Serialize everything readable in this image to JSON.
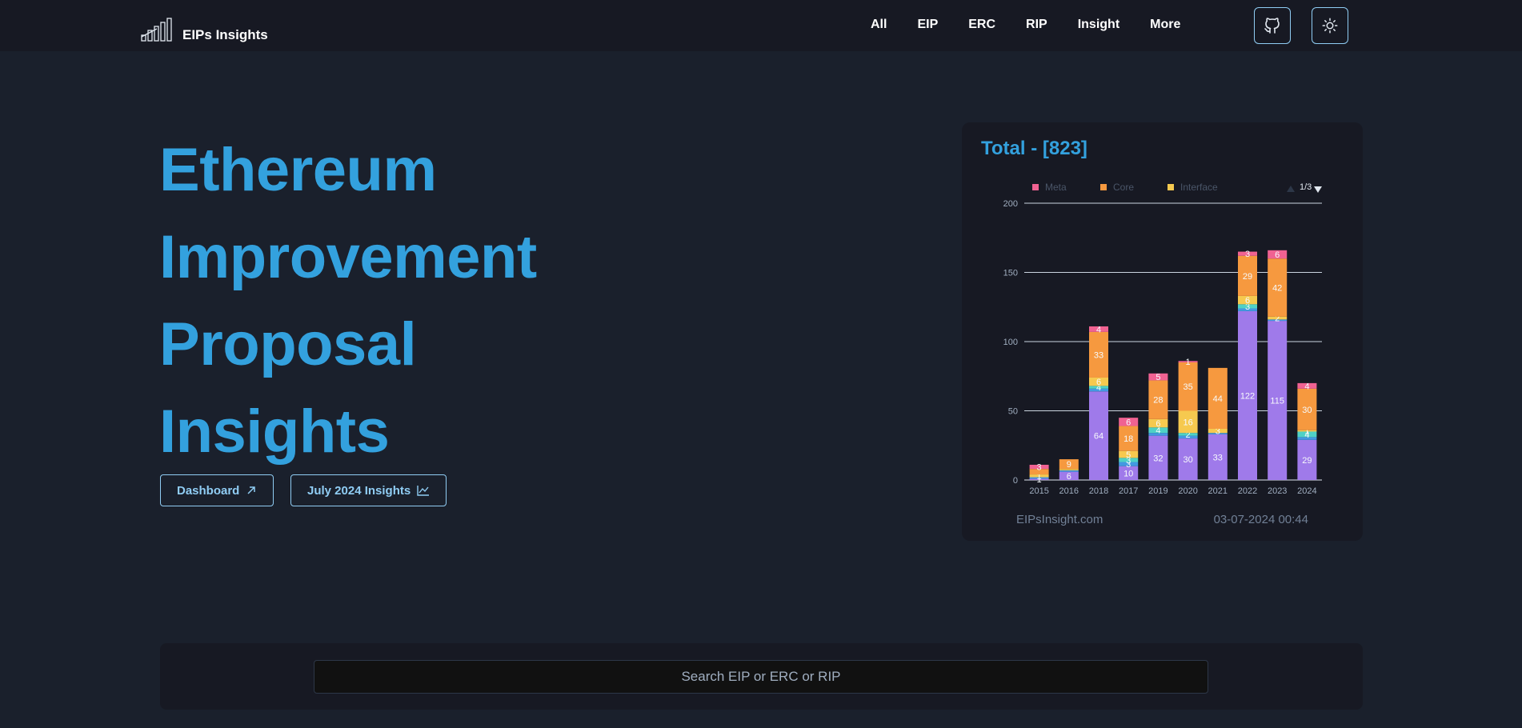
{
  "nav": {
    "brand": "EIPs Insights",
    "links": [
      "All",
      "EIP",
      "ERC",
      "RIP",
      "Insight",
      "More"
    ],
    "github_icon": "github-icon",
    "theme_icon": "sun-icon"
  },
  "hero": {
    "title_lines": [
      "Ethereum",
      "Improvement",
      "Proposal",
      "Insights"
    ],
    "dashboard_label": "Dashboard",
    "insights_label": "July 2024 Insights"
  },
  "chart_card": {
    "title": "Total - [823]",
    "footer_left": "EIPsInsight.com",
    "footer_right": "03-07-2024 00:44",
    "legend_page": "1/3"
  },
  "search": {
    "placeholder": "Search EIP or ERC or RIP"
  },
  "colors": {
    "accent": "#33a1de",
    "meta": "#f06292",
    "core": "#f6993f",
    "interface": "#f6c94f",
    "networking": "#4fd1c5",
    "informational": "#4299e1",
    "standards": "#9f7aea"
  },
  "chart_data": {
    "type": "bar",
    "stacked": true,
    "categories": [
      "2015",
      "2016",
      "2018",
      "2017",
      "2019",
      "2020",
      "2021",
      "2022",
      "2023",
      "2024"
    ],
    "ylim": [
      0,
      200
    ],
    "yticks": [
      0,
      50,
      100,
      150,
      200
    ],
    "grid": true,
    "legend_position": "top",
    "legend": [
      "Meta",
      "Core",
      "Interface"
    ],
    "series": [
      {
        "color": "#9f7aea",
        "values": [
          1,
          6,
          64,
          10,
          32,
          30,
          33,
          122,
          115,
          29
        ]
      },
      {
        "color": "#4299e1",
        "values": [
          1,
          1,
          2,
          3,
          2,
          2,
          1,
          2,
          1,
          2
        ]
      },
      {
        "color": "#4fd1c5",
        "values": [
          0,
          0,
          2,
          3,
          4,
          2,
          0,
          3,
          0,
          4
        ]
      },
      {
        "color": "#f6c94f",
        "values": [
          2,
          1,
          6,
          5,
          6,
          16,
          3,
          6,
          2,
          1
        ]
      },
      {
        "color": "#f6993f",
        "values": [
          4,
          7,
          33,
          18,
          28,
          35,
          44,
          29,
          42,
          30
        ]
      },
      {
        "name": "Meta",
        "color": "#f06292",
        "values": [
          3,
          0,
          4,
          6,
          5,
          1,
          0,
          3,
          6,
          4
        ]
      }
    ],
    "labels": [
      [
        "1",
        "6",
        "64",
        "10",
        "32",
        "30",
        "33",
        "122",
        "115",
        "29"
      ],
      [
        "",
        "",
        "",
        "3",
        "",
        "",
        "",
        "",
        "",
        ""
      ],
      [
        "",
        "",
        "4",
        "3",
        "4",
        "2",
        "",
        "3",
        "",
        "4"
      ],
      [
        "1",
        "",
        "6",
        "5",
        "6",
        "16",
        "3",
        "6",
        "2",
        "1"
      ],
      [
        "",
        "9",
        "33",
        "18",
        "28",
        "35",
        "44",
        "29",
        "42",
        "30"
      ],
      [
        "3",
        "",
        "4",
        "6",
        "5",
        "1",
        "",
        "3",
        "6",
        "4"
      ]
    ]
  }
}
